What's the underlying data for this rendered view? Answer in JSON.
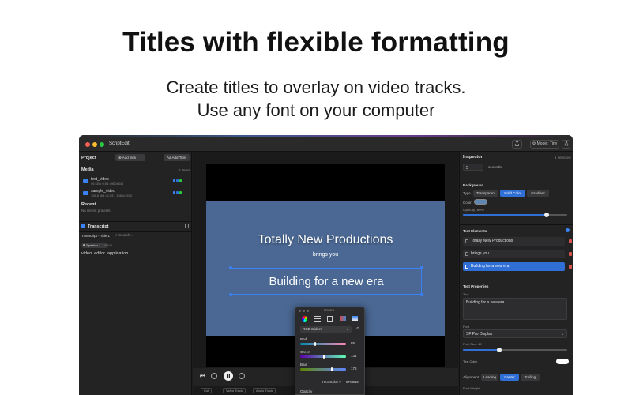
{
  "hero": {
    "title": "Titles with flexible formatting",
    "subtitle_line1": "Create titles to overlay on video tracks.",
    "subtitle_line2": "Use any font on your computer"
  },
  "app": {
    "name": "ScriptEdit",
    "model_label": "Model: Tiny",
    "colors": {
      "accent": "#2f6fd6",
      "selection": "#3a82f6",
      "close": "#ff5f57",
      "minimize": "#febc2e",
      "zoom": "#28c840",
      "frame": "#4a6893",
      "danger": "#d9534f"
    }
  },
  "project": {
    "heading": "Project",
    "add_files": "Add files",
    "add_title": "Add Title",
    "media_heading": "Media",
    "media_count": "2 items",
    "media": [
      {
        "name": "test_video",
        "meta": "96 KB  •  0:05  •  960x540"
      },
      {
        "name": "sample_video",
        "meta": "758.6 MB  •  1:03  •  1080x1920"
      }
    ],
    "recent_heading": "Recent",
    "recent_empty": "No recent projects"
  },
  "transcript": {
    "heading": "Transcript",
    "breadcrumb": "Transcript - Title 1",
    "search_placeholder": "Search...",
    "speaker": "Speaker 1",
    "time": "00:03",
    "words": [
      "video",
      "editor",
      "application"
    ]
  },
  "preview": {
    "title1": "Totally New Productions",
    "title2": "brings you",
    "title3": "Building for a new era",
    "toolbar": [
      "Cut",
      "Video Track",
      "Audio Track"
    ]
  },
  "inspector": {
    "heading": "Inspector",
    "selected": "1 selected",
    "duration_value": "5",
    "duration_unit": "seconds",
    "background_heading": "Background",
    "type_label": "Type",
    "type_options": [
      "Transparent",
      "Solid Color",
      "Gradient"
    ],
    "type_selected": "Solid Color",
    "color_label": "Color",
    "opacity_label": "Opacity: 80%",
    "opacity": 0.8,
    "elements_heading": "Text Elements",
    "elements": [
      "Totally New Productions",
      "brings you",
      "Building for a new era"
    ],
    "properties_heading": "Text Properties",
    "text_label": "Text",
    "text_value": "Building for a new era",
    "font_label": "Font",
    "font_value": "SF Pro Display",
    "font_size_label": "Font Size: 49",
    "font_size_fraction": 0.35,
    "text_color_label": "Text Color",
    "alignment_label": "Alignment",
    "alignment_options": [
      "Leading",
      "Center",
      "Trailing"
    ],
    "alignment_selected": "Center",
    "font_weight_label": "Font Weight"
  },
  "colors_panel": {
    "title": "Colors",
    "mode": "RGB Sliders",
    "red_label": "Red",
    "red": 85,
    "green_label": "Green",
    "green": 134,
    "blue_label": "Blue",
    "blue": 176,
    "hex_label": "Hex Color #",
    "hex": "5F86B2",
    "opacity_label": "Opacity"
  }
}
